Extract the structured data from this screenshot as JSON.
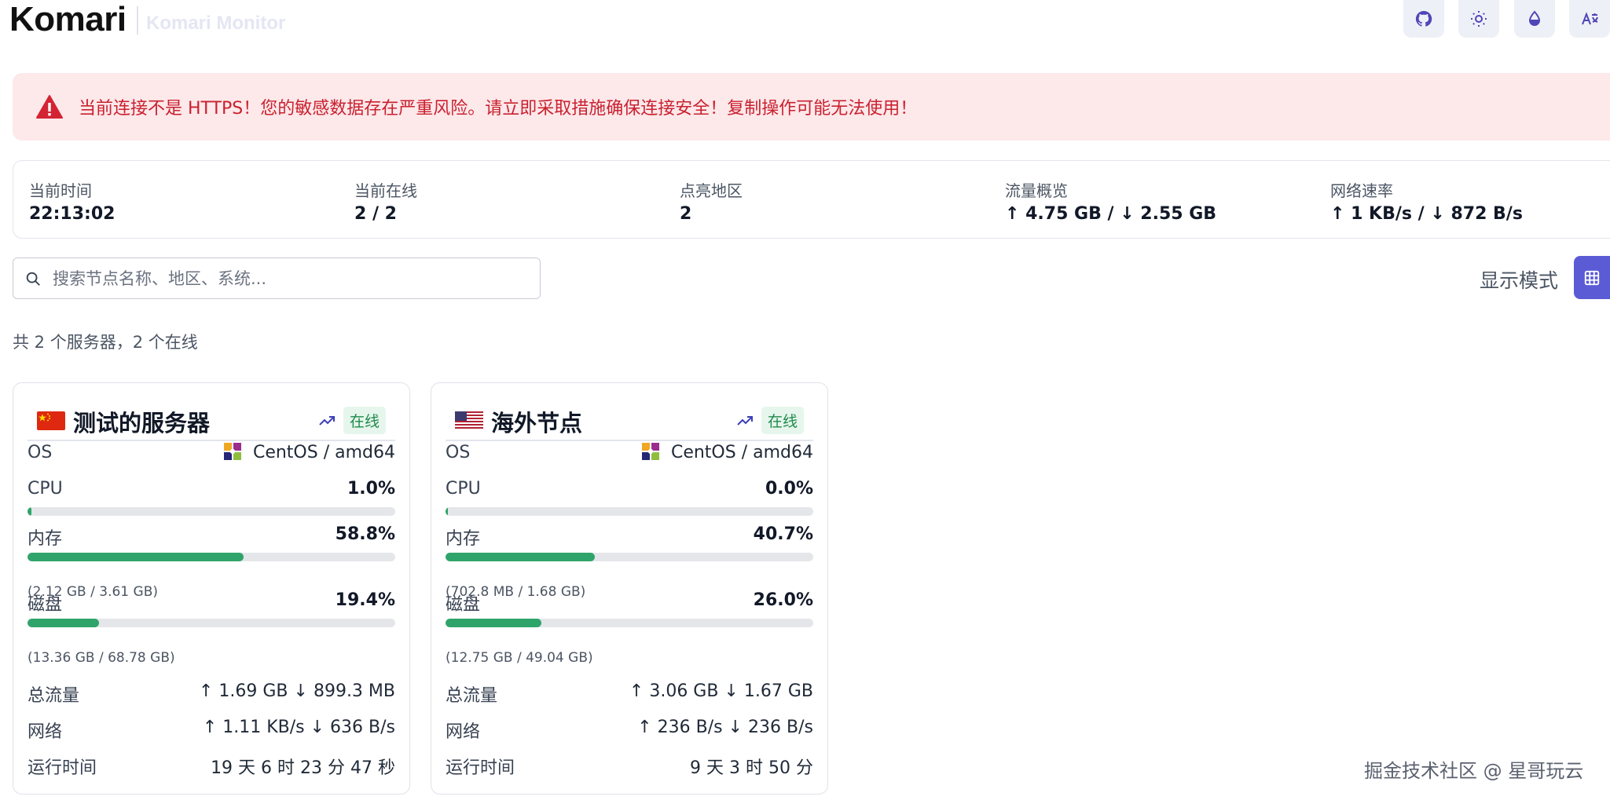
{
  "header": {
    "logo": "Komari",
    "subtitle": "Komari Monitor",
    "icons": [
      "github-icon",
      "sun-icon",
      "droplet-icon",
      "translate-icon"
    ]
  },
  "alert": {
    "text": "当前连接不是 HTTPS！您的敏感数据存在严重风险。请立即采取措施确保连接安全！复制操作可能无法使用！",
    "color": "#c9212f"
  },
  "stats": {
    "time_label": "当前时间",
    "time_value": "22:13:02",
    "online_label": "当前在线",
    "online_value": "2 / 2",
    "regions_label": "点亮地区",
    "regions_value": "2",
    "traffic_label": "流量概览",
    "traffic_value": "↑ 4.75 GB / ↓ 2.55 GB",
    "speed_label": "网络速率",
    "speed_value": "↑ 1 KB/s / ↓ 872 B/s"
  },
  "search": {
    "placeholder": "搜索节点名称、地区、系统..."
  },
  "display_mode": {
    "label": "显示模式"
  },
  "summary": "共 2 个服务器，2 个在线",
  "accent": "#5b5bd6",
  "bar_color": "#2fa46a",
  "servers": [
    {
      "name": "测试的服务器",
      "flag": "cn",
      "status": "在线",
      "os_label": "OS",
      "os": "CentOS / amd64",
      "cpu_label": "CPU",
      "cpu": "1.0%",
      "cpu_pct": 1.0,
      "mem_label": "内存",
      "mem": "58.8%",
      "mem_pct": 58.8,
      "mem_detail": "(2.12 GB / 3.61 GB)",
      "disk_label": "磁盘",
      "disk": "19.4%",
      "disk_pct": 19.4,
      "disk_detail": "(13.36 GB / 68.78 GB)",
      "traffic_label": "总流量",
      "traffic": "↑ 1.69 GB ↓ 899.3 MB",
      "net_label": "网络",
      "net": "↑ 1.11 KB/s ↓ 636 B/s",
      "uptime_label": "运行时间",
      "uptime": "19 天 6 时 23 分 47 秒"
    },
    {
      "name": "海外节点",
      "flag": "us",
      "status": "在线",
      "os_label": "OS",
      "os": "CentOS / amd64",
      "cpu_label": "CPU",
      "cpu": "0.0%",
      "cpu_pct": 0.0,
      "mem_label": "内存",
      "mem": "40.7%",
      "mem_pct": 40.7,
      "mem_detail": "(702.8 MB / 1.68 GB)",
      "disk_label": "磁盘",
      "disk": "26.0%",
      "disk_pct": 26.0,
      "disk_detail": "(12.75 GB / 49.04 GB)",
      "traffic_label": "总流量",
      "traffic": "↑ 3.06 GB ↓ 1.67 GB",
      "net_label": "网络",
      "net": "↑ 236 B/s ↓ 236 B/s",
      "uptime_label": "运行时间",
      "uptime": "9 天 3 时 50 分"
    }
  ],
  "watermark": "掘金技术社区 @ 星哥玩云"
}
